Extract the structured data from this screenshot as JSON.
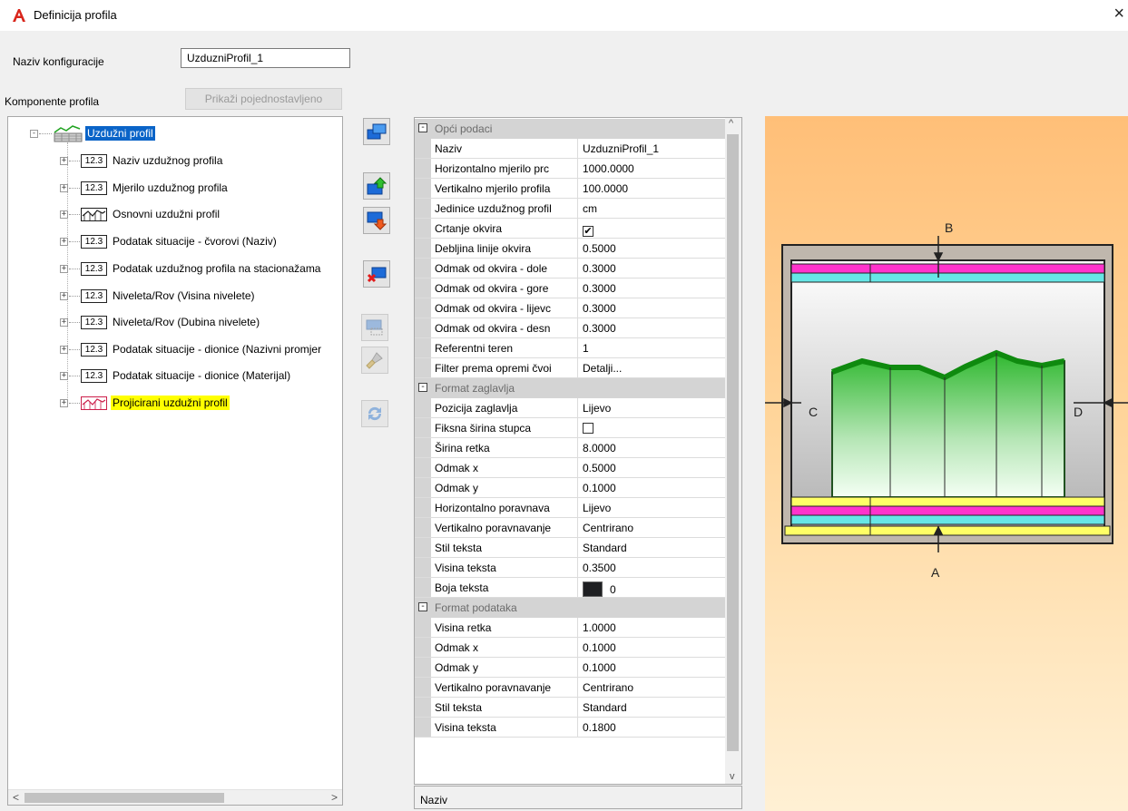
{
  "window": {
    "title": "Definicija profila",
    "close_glyph": "×"
  },
  "config": {
    "label": "Naziv konfiguracije",
    "value": "UzduzniProfil_1"
  },
  "components": {
    "label": "Komponente profila",
    "simplified_button": "Prikaži pojednostavljeno"
  },
  "tree": {
    "root": "Uzdužni profil",
    "items": [
      {
        "icon": "123",
        "label": "Naziv uzdužnog profila"
      },
      {
        "icon": "123",
        "label": "Mjerilo uzdužnog profila"
      },
      {
        "icon": "profile-graph",
        "label": "Osnovni uzdužni profil"
      },
      {
        "icon": "123",
        "label": "Podatak situacije - čvorovi (Naziv)"
      },
      {
        "icon": "123",
        "label": "Podatak uzdužnog profila na stacionažama"
      },
      {
        "icon": "123",
        "label": "Niveleta/Rov (Visina nivelete)"
      },
      {
        "icon": "123",
        "label": "Niveleta/Rov (Dubina nivelete)"
      },
      {
        "icon": "123",
        "label": "Podatak situacije - dionice (Nazivni promjer"
      },
      {
        "icon": "123",
        "label": "Podatak situacije - dionice (Materijal)"
      },
      {
        "icon": "profile-graph-red",
        "label": "Projicirani uzdužni profil"
      }
    ],
    "icon_text": "12.3",
    "scroll_left": "<",
    "scroll_right": ">"
  },
  "toolbar": {
    "buttons": [
      "copy-icon",
      "move-up-icon",
      "move-down-icon",
      "delete-icon",
      "properties-icon",
      "paint-icon",
      "refresh-icon"
    ]
  },
  "propgrid": {
    "sections": [
      {
        "title": "Opći podaci",
        "rows": [
          {
            "name": "Naziv",
            "value": "UzduzniProfil_1"
          },
          {
            "name": "Horizontalno mjerilo prc",
            "value": "1000.0000"
          },
          {
            "name": "Vertikalno mjerilo profila",
            "value": "100.0000"
          },
          {
            "name": "Jedinice uzdužnog profil",
            "value": "cm"
          },
          {
            "name": "Crtanje okvira",
            "value": "✔",
            "type": "checkbox"
          },
          {
            "name": "Debljina linije okvira",
            "value": "0.5000"
          },
          {
            "name": "Odmak od okvira - dole",
            "value": "0.3000"
          },
          {
            "name": "Odmak od okvira - gore",
            "value": "0.3000"
          },
          {
            "name": "Odmak od okvira - lijevc",
            "value": "0.3000"
          },
          {
            "name": "Odmak od okvira - desn",
            "value": "0.3000"
          },
          {
            "name": "Referentni teren",
            "value": "1"
          },
          {
            "name": "Filter prema opremi čvoi",
            "value": "Detalji..."
          }
        ]
      },
      {
        "title": "Format zaglavlja",
        "rows": [
          {
            "name": "Pozicija zaglavlja",
            "value": "Lijevo"
          },
          {
            "name": "Fiksna širina stupca",
            "value": "",
            "type": "checkbox"
          },
          {
            "name": "Širina retka",
            "value": "8.0000"
          },
          {
            "name": "Odmak x",
            "value": "0.5000"
          },
          {
            "name": "Odmak y",
            "value": "0.1000"
          },
          {
            "name": "Horizontalno poravnava",
            "value": "Lijevo"
          },
          {
            "name": "Vertikalno poravnavanje",
            "value": "Centrirano"
          },
          {
            "name": "Stil teksta",
            "value": "Standard"
          },
          {
            "name": "Visina teksta",
            "value": "0.3500"
          },
          {
            "name": "Boja teksta",
            "value": "0",
            "type": "color",
            "color": "#1e1f22"
          }
        ]
      },
      {
        "title": "Format podataka",
        "rows": [
          {
            "name": "Visina retka",
            "value": "1.0000"
          },
          {
            "name": "Odmak x",
            "value": "0.1000"
          },
          {
            "name": "Odmak y",
            "value": "0.1000"
          },
          {
            "name": "Vertikalno poravnavanje",
            "value": "Centrirano"
          },
          {
            "name": "Stil teksta",
            "value": "Standard"
          },
          {
            "name": "Visina teksta",
            "value": "0.1800"
          }
        ]
      }
    ],
    "scroll_up": "^",
    "scroll_down": "v",
    "description": "Naziv"
  },
  "preview": {
    "labels": {
      "top": "B",
      "bottom": "A",
      "left": "C",
      "right": "D"
    },
    "colors": {
      "magenta": "#ff33cc",
      "cyan": "#66e6e6",
      "yellow": "#ffff66",
      "terrain": "#22b022",
      "frame": "#ffffff"
    }
  }
}
